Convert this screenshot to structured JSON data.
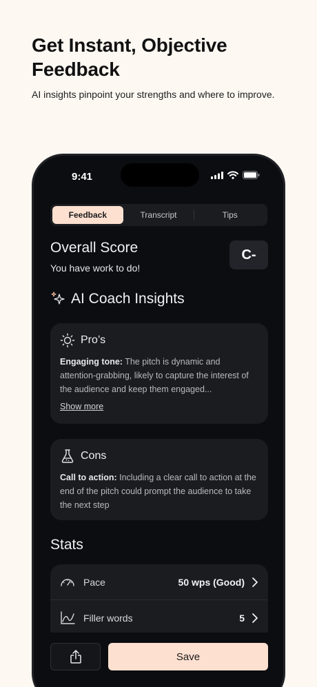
{
  "hero": {
    "title": "Get Instant, Objective Feedback",
    "subtitle": "AI insights pinpoint your strengths and where to improve."
  },
  "status_bar": {
    "time": "9:41"
  },
  "tabs": [
    {
      "label": "Feedback",
      "active": true
    },
    {
      "label": "Transcript",
      "active": false
    },
    {
      "label": "Tips",
      "active": false
    }
  ],
  "overall": {
    "title": "Overall Score",
    "subtitle": "You have work to do!",
    "grade": "C-"
  },
  "insights": {
    "title": "AI Coach Insights",
    "pros": {
      "title": "Pro’s",
      "lead": "Engaging tone:",
      "text": " The pitch is dynamic and attention-grabbing, likely to capture the interest of the audience and keep them engaged...",
      "more": "Show more"
    },
    "cons": {
      "title": "Cons",
      "lead": "Call to action:",
      "text": " Including a clear call to action at the end of the pitch could prompt the audience to take the next step"
    }
  },
  "stats": {
    "title": "Stats",
    "rows": [
      {
        "label": "Pace",
        "value": "50 wps (Good)",
        "icon": "speedometer-icon"
      },
      {
        "label": "Filler words",
        "value": "5",
        "icon": "line-chart-icon"
      }
    ]
  },
  "actions": {
    "save_label": "Save"
  },
  "colors": {
    "accent": "#fde0d0",
    "phone_bg": "#0c0d10",
    "card_bg": "#1b1c20",
    "page_bg": "#fdf8f2"
  }
}
